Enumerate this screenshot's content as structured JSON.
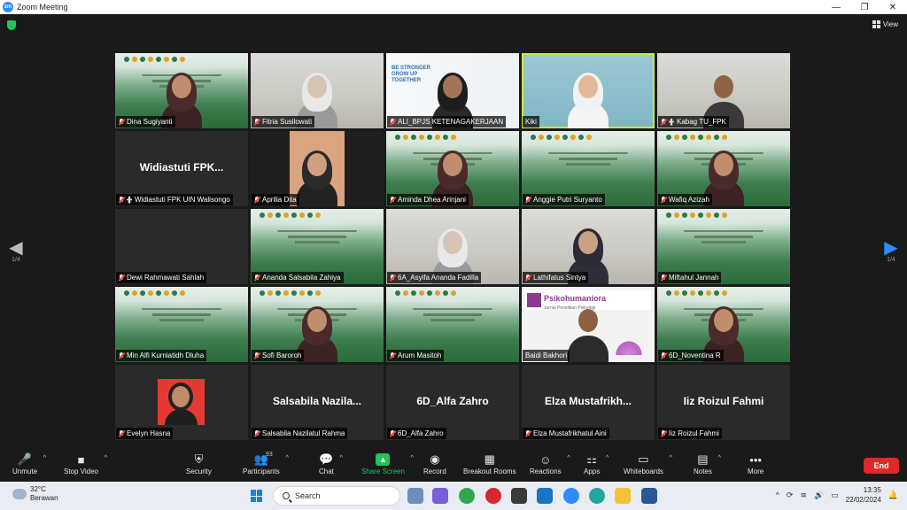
{
  "window": {
    "title": "Zoom Meeting",
    "app_icon": "zoom",
    "minimize": "—",
    "maximize": "❐",
    "close": "✕"
  },
  "top": {
    "view_label": "View"
  },
  "pager": {
    "left": "1/4",
    "right": "1/4"
  },
  "tiles": [
    {
      "name": "Dina Sugiyanti",
      "kind": "banner-person",
      "muted": true,
      "host": false
    },
    {
      "name": "Fitria Susilowati",
      "kind": "photo-light",
      "muted": true,
      "host": false
    },
    {
      "name": "ALI_BPJS KETENAGAKERJAAN",
      "kind": "bpjs",
      "muted": true,
      "host": false
    },
    {
      "name": "Kiki",
      "kind": "blue-person",
      "muted": false,
      "host": false,
      "active": true
    },
    {
      "name": "Kabag TU_FPK",
      "kind": "photo-man",
      "muted": true,
      "host": true
    },
    {
      "name": "Widiastuti FPK UIN Walisongo",
      "big": "Widiastuti FPK...",
      "kind": "name-only",
      "muted": true,
      "host": true
    },
    {
      "name": "Aprilia Dita",
      "kind": "dark-person",
      "muted": true,
      "host": false
    },
    {
      "name": "Aminda Dhea Arinjani",
      "kind": "banner-person",
      "muted": true,
      "host": false
    },
    {
      "name": "Anggie Putri Suryanto",
      "kind": "banner",
      "muted": true,
      "host": false
    },
    {
      "name": "Wafiq Azizah",
      "kind": "banner-person",
      "muted": true,
      "host": false
    },
    {
      "name": "Dewi Rahmawati Sahlah",
      "kind": "empty",
      "muted": true,
      "host": false
    },
    {
      "name": "Ananda Salsabila Zahiya",
      "kind": "banner",
      "muted": true,
      "host": false
    },
    {
      "name": "6A_Asyifa Ananda Fadilla",
      "kind": "photo-light",
      "muted": true,
      "host": false
    },
    {
      "name": "Lathifatus Sintya",
      "kind": "photo-person",
      "muted": true,
      "host": false
    },
    {
      "name": "Miftahul Jannah",
      "kind": "banner",
      "muted": true,
      "host": false
    },
    {
      "name": "Min Alfi Kurniatidh Dluha",
      "kind": "banner",
      "muted": true,
      "host": false
    },
    {
      "name": "Sofi Baroroh",
      "kind": "banner-person",
      "muted": true,
      "host": false
    },
    {
      "name": "Arum Masitoh",
      "kind": "banner",
      "muted": true,
      "host": false
    },
    {
      "name": "Baidi Bakhori",
      "kind": "psiko",
      "muted": false,
      "host": false
    },
    {
      "name": "6D_Noventina R",
      "kind": "banner-person",
      "muted": true,
      "host": false
    },
    {
      "name": "Evelyn Hasna",
      "kind": "red-avatar",
      "muted": true,
      "host": false
    },
    {
      "name": "Salsabila Nazilatul Rahma",
      "big": "Salsabila  Nazila...",
      "kind": "name-only",
      "muted": true,
      "host": false
    },
    {
      "name": "6D_Alfa Zahro",
      "big": "6D_Alfa Zahro",
      "kind": "name-only",
      "muted": true,
      "host": false
    },
    {
      "name": "Elza Mustafrikhatul Aini",
      "big": "Elza  Mustafrikh...",
      "kind": "name-only",
      "muted": true,
      "host": false
    },
    {
      "name": "Iiz Roizul Fahmi",
      "big": "Iiz Roizul Fahmi",
      "kind": "name-only",
      "muted": true,
      "host": false
    }
  ],
  "bpjs": {
    "line1": "BE STRONGER",
    "line2": "GROW UP",
    "line3": "TOGETHER"
  },
  "psiko": {
    "title": "Psikohumaniora",
    "subtitle": "Jurnal Penelitian Psikologi"
  },
  "toolbar": {
    "unmute": "Unmute",
    "stop_video": "Stop Video",
    "security": "Security",
    "participants": "Participants",
    "participants_count": "93",
    "chat": "Chat",
    "share_screen": "Share Screen",
    "record": "Record",
    "breakout": "Breakout Rooms",
    "reactions": "Reactions",
    "apps": "Apps",
    "whiteboards": "Whiteboards",
    "notes": "Notes",
    "more": "More",
    "end": "End"
  },
  "taskbar": {
    "temp": "32°C",
    "weather": "Berawan",
    "search": "Search",
    "time": "13:35",
    "date": "22/02/2024"
  },
  "colors": {
    "accent": "#2d8cff",
    "share_green": "#23c35a",
    "end_red": "#e02828",
    "active_border": "#c9e93a"
  }
}
